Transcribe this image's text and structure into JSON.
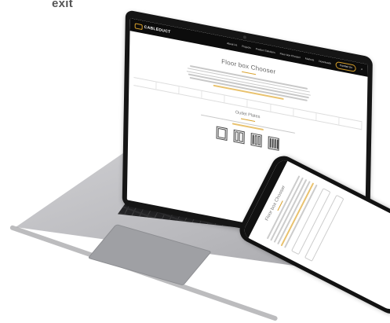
{
  "overlay": {
    "corner_text": "exit"
  },
  "site": {
    "logo_text": "CABLEDUCT",
    "nav": {
      "links": [
        "About Us",
        "Projects",
        "Product Solutions",
        "Floor box Chooser",
        "Markets",
        "Downloads"
      ],
      "cta": "Contact Us",
      "search_icon": "search-icon"
    },
    "page_title": "Floor box Chooser",
    "section_title": "Outlet Plates",
    "accent_color": "#d8a02a"
  },
  "phone": {
    "page_title": "Floor box Chooser"
  }
}
